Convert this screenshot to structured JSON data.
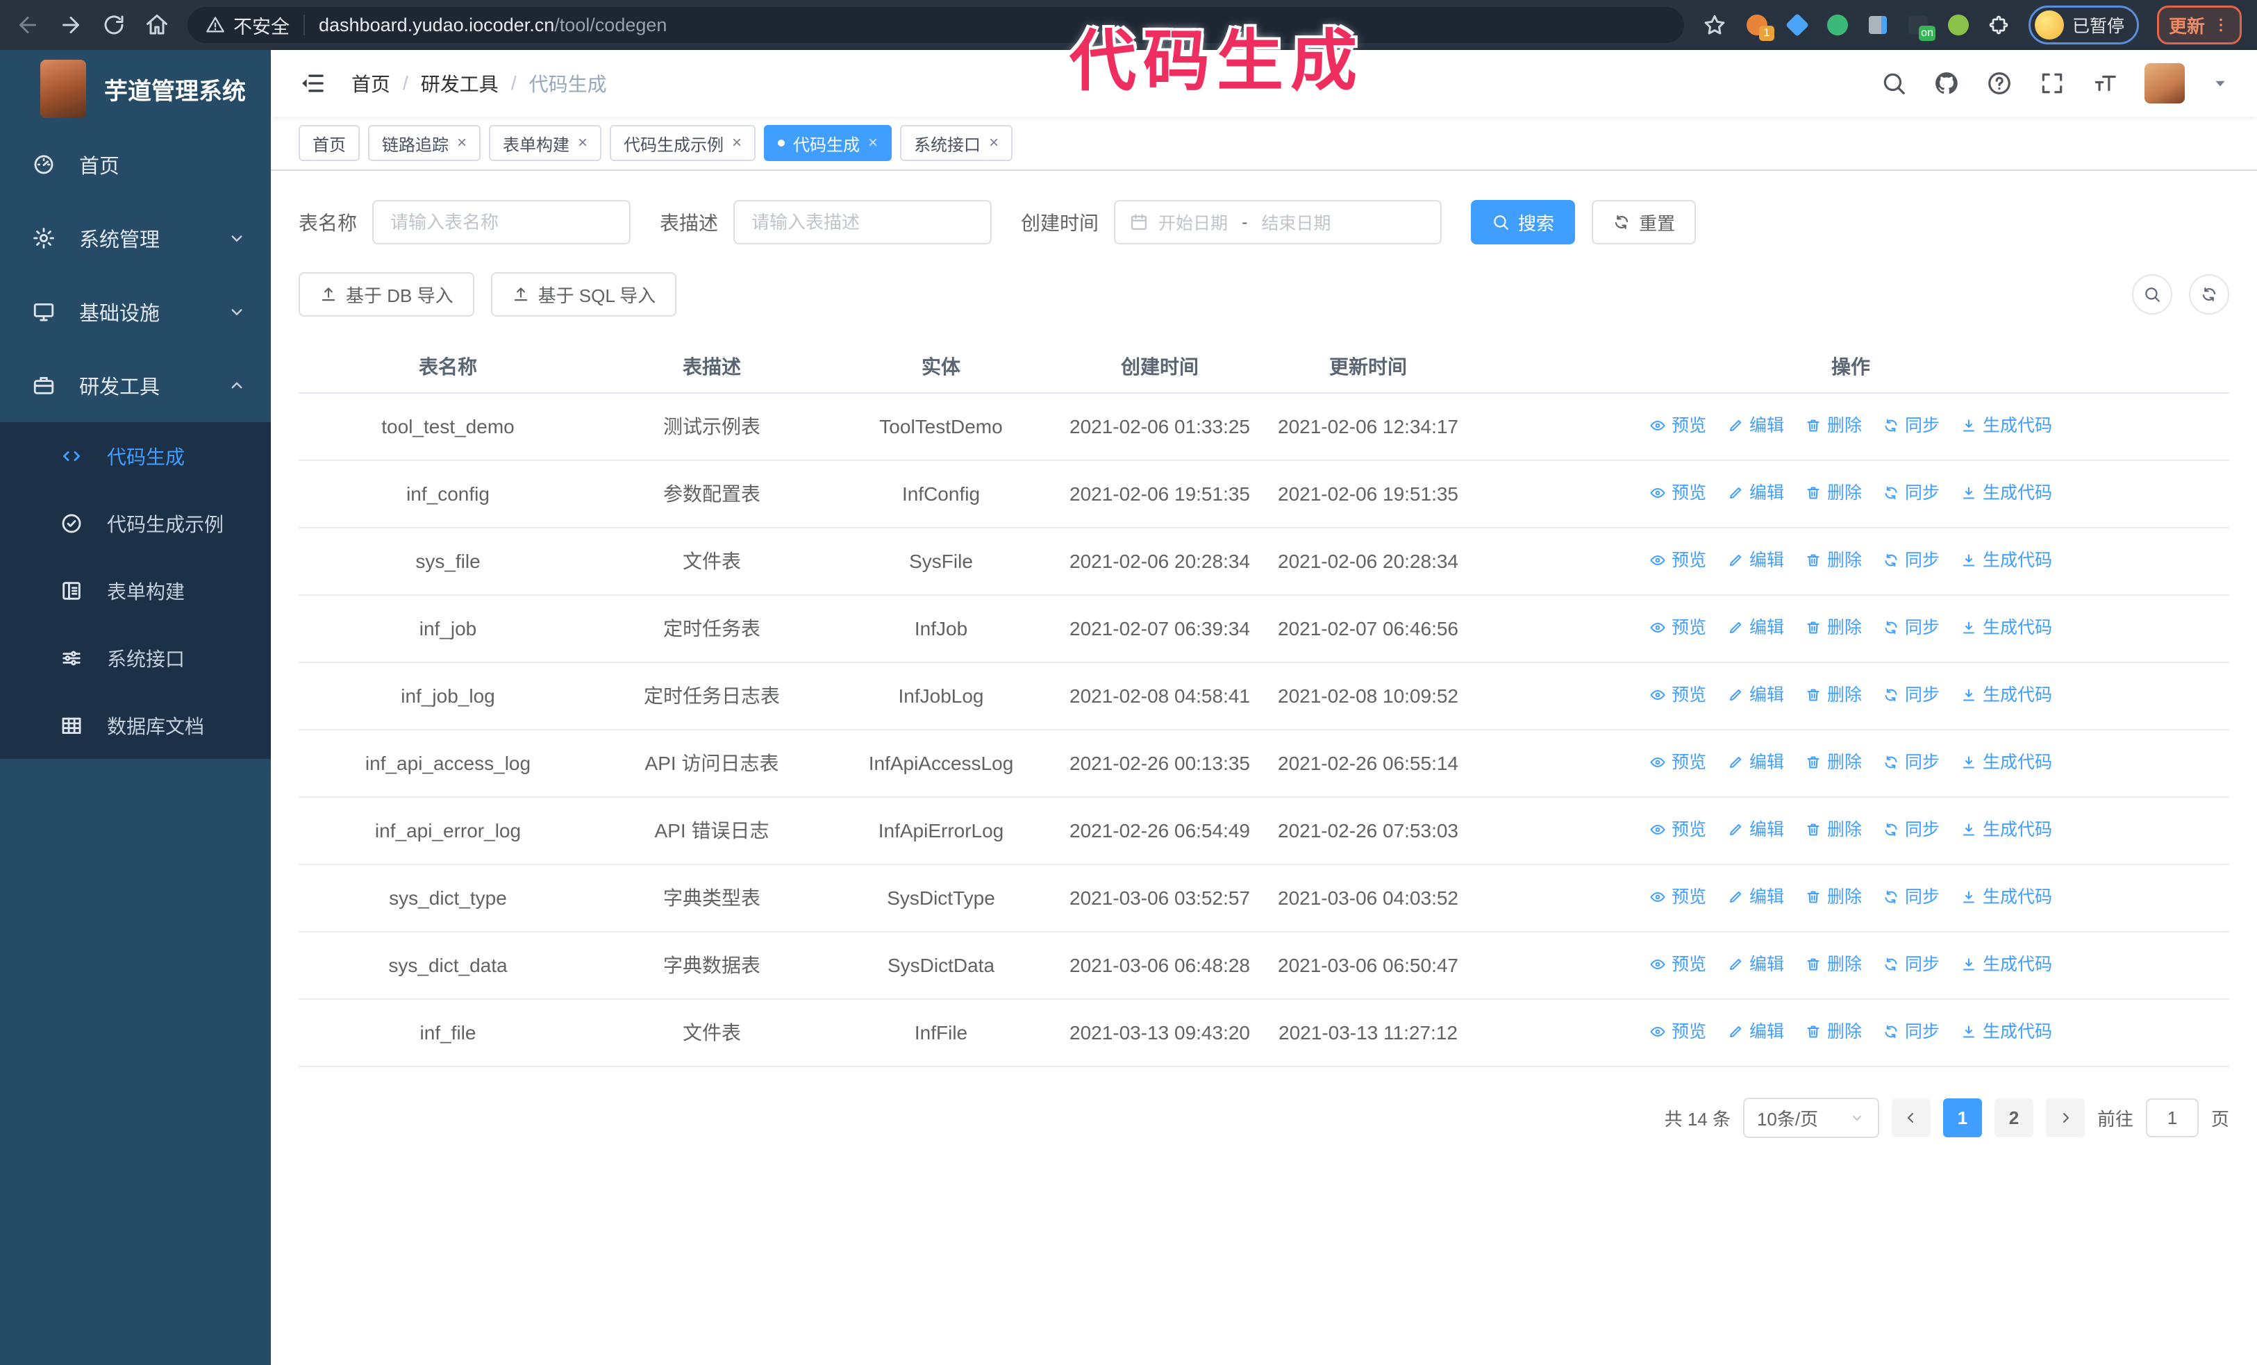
{
  "browser": {
    "security_warning": "不安全",
    "url_host": "dashboard.yudao.iocoder.cn",
    "url_path": "/tool/codegen",
    "profile_label": "已暂停",
    "update_label": "更新",
    "extensions": [
      {
        "name": "extension-sync-icon",
        "shape": "circle",
        "color": "#e8833a",
        "badge": "1",
        "badge_color": "#e8a33a"
      },
      {
        "name": "extension-gem-icon",
        "shape": "diamond",
        "color": "#4aa3f5"
      },
      {
        "name": "extension-check-icon",
        "shape": "circle",
        "color": "#3cb878"
      },
      {
        "name": "extension-stats-icon",
        "shape": "bars",
        "color": "#aab4bd"
      },
      {
        "name": "extension-switch-icon",
        "shape": "square",
        "color": "#2f3b45",
        "badge": "on",
        "badge_color": "#35b558"
      },
      {
        "name": "extension-octo-icon",
        "shape": "circle",
        "color": "#8bc34a"
      },
      {
        "name": "extension-puzzle-icon",
        "shape": "puzzle",
        "color": "#e9edf2"
      }
    ]
  },
  "annotation": {
    "text": "代码生成",
    "color": "#ee2e5f"
  },
  "sidebar": {
    "title": "芋道管理系统",
    "items": [
      {
        "key": "home",
        "label": "首页",
        "icon": "dashboard-icon"
      },
      {
        "key": "system",
        "label": "系统管理",
        "icon": "gear-icon",
        "chevron": "down"
      },
      {
        "key": "infra",
        "label": "基础设施",
        "icon": "monitor-icon",
        "chevron": "down"
      },
      {
        "key": "devtools",
        "label": "研发工具",
        "icon": "toolbox-icon",
        "chevron": "up",
        "expanded": true
      }
    ],
    "submenu": [
      {
        "key": "codegen",
        "label": "代码生成",
        "icon": "code-icon",
        "active": true
      },
      {
        "key": "codegen-example",
        "label": "代码生成示例",
        "icon": "example-icon"
      },
      {
        "key": "form-builder",
        "label": "表单构建",
        "icon": "form-icon"
      },
      {
        "key": "system-api",
        "label": "系统接口",
        "icon": "api-icon"
      },
      {
        "key": "db-doc",
        "label": "数据库文档",
        "icon": "db-doc-icon"
      }
    ]
  },
  "header": {
    "breadcrumb": [
      "首页",
      "研发工具",
      "代码生成"
    ]
  },
  "tabs": [
    {
      "key": "home",
      "label": "首页",
      "closable": false
    },
    {
      "key": "tracing",
      "label": "链路追踪",
      "closable": true
    },
    {
      "key": "form-builder",
      "label": "表单构建",
      "closable": true
    },
    {
      "key": "codegen-example",
      "label": "代码生成示例",
      "closable": true
    },
    {
      "key": "codegen",
      "label": "代码生成",
      "closable": true,
      "active": true
    },
    {
      "key": "system-api",
      "label": "系统接口",
      "closable": true
    }
  ],
  "filters": {
    "table_name_label": "表名称",
    "table_name_placeholder": "请输入表名称",
    "table_desc_label": "表描述",
    "table_desc_placeholder": "请输入表描述",
    "create_time_label": "创建时间",
    "date_start_placeholder": "开始日期",
    "date_separator": "-",
    "date_end_placeholder": "结束日期",
    "search_label": "搜索",
    "reset_label": "重置"
  },
  "toolbar": {
    "import_db_label": "基于 DB 导入",
    "import_sql_label": "基于 SQL 导入"
  },
  "table": {
    "columns": [
      "表名称",
      "表描述",
      "实体",
      "创建时间",
      "更新时间",
      "操作"
    ],
    "actions": [
      {
        "key": "preview",
        "label": "预览",
        "icon": "eye-icon"
      },
      {
        "key": "edit",
        "label": "编辑",
        "icon": "edit-icon"
      },
      {
        "key": "delete",
        "label": "删除",
        "icon": "delete-icon"
      },
      {
        "key": "sync",
        "label": "同步",
        "icon": "refresh-icon"
      },
      {
        "key": "generate",
        "label": "生成代码",
        "icon": "download-icon"
      }
    ],
    "rows": [
      {
        "name": "tool_test_demo",
        "desc": "测试示例表",
        "entity": "ToolTestDemo",
        "created": "2021-02-06 01:33:25",
        "updated": "2021-02-06 12:34:17"
      },
      {
        "name": "inf_config",
        "desc": "参数配置表",
        "entity": "InfConfig",
        "created": "2021-02-06 19:51:35",
        "updated": "2021-02-06 19:51:35"
      },
      {
        "name": "sys_file",
        "desc": "文件表",
        "entity": "SysFile",
        "created": "2021-02-06 20:28:34",
        "updated": "2021-02-06 20:28:34"
      },
      {
        "name": "inf_job",
        "desc": "定时任务表",
        "entity": "InfJob",
        "created": "2021-02-07 06:39:34",
        "updated": "2021-02-07 06:46:56"
      },
      {
        "name": "inf_job_log",
        "desc": "定时任务日志表",
        "entity": "InfJobLog",
        "created": "2021-02-08 04:58:41",
        "updated": "2021-02-08 10:09:52"
      },
      {
        "name": "inf_api_access_log",
        "desc": "API 访问日志表",
        "entity": "InfApiAccessLog",
        "created": "2021-02-26 00:13:35",
        "updated": "2021-02-26 06:55:14"
      },
      {
        "name": "inf_api_error_log",
        "desc": "API 错误日志",
        "entity": "InfApiErrorLog",
        "created": "2021-02-26 06:54:49",
        "updated": "2021-02-26 07:53:03"
      },
      {
        "name": "sys_dict_type",
        "desc": "字典类型表",
        "entity": "SysDictType",
        "created": "2021-03-06 03:52:57",
        "updated": "2021-03-06 04:03:52"
      },
      {
        "name": "sys_dict_data",
        "desc": "字典数据表",
        "entity": "SysDictData",
        "created": "2021-03-06 06:48:28",
        "updated": "2021-03-06 06:50:47"
      },
      {
        "name": "inf_file",
        "desc": "文件表",
        "entity": "InfFile",
        "created": "2021-03-13 09:43:20",
        "updated": "2021-03-13 11:27:12"
      }
    ]
  },
  "pagination": {
    "total": "共 14 条",
    "page_size": "10条/页",
    "pages": [
      "1",
      "2"
    ],
    "active_page": "1",
    "goto_label": "前往",
    "goto_value": "1",
    "page_unit": "页"
  },
  "colors": {
    "accent": "#409eff"
  }
}
